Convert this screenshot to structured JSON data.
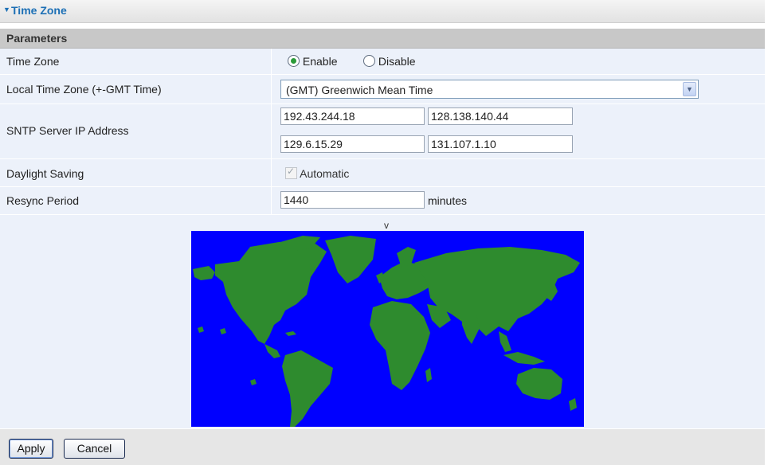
{
  "header": {
    "title": "Time Zone"
  },
  "section": {
    "title": "Parameters"
  },
  "rows": {
    "time_zone": {
      "label": "Time Zone",
      "enable_label": "Enable",
      "disable_label": "Disable",
      "selected": "Enable"
    },
    "local_tz": {
      "label": "Local Time Zone (+-GMT Time)",
      "value": "(GMT) Greenwich Mean Time"
    },
    "sntp": {
      "label": "SNTP Server IP Address",
      "servers": [
        "192.43.244.18",
        "128.138.140.44",
        "129.6.15.29",
        "131.107.1.10"
      ]
    },
    "daylight": {
      "label": "Daylight Saving",
      "checkbox_label": "Automatic",
      "checked": true
    },
    "resync": {
      "label": "Resync Period",
      "value": "1440",
      "unit": "minutes"
    }
  },
  "map": {
    "marker": "v"
  },
  "buttons": {
    "apply": "Apply",
    "cancel": "Cancel"
  },
  "colors": {
    "ocean": "#0000ff",
    "land": "#2e8b2e",
    "title": "#1c6fb5"
  },
  "icons": {
    "caret": "collapse-triangle-icon",
    "dropdown": "chevron-down-icon"
  }
}
